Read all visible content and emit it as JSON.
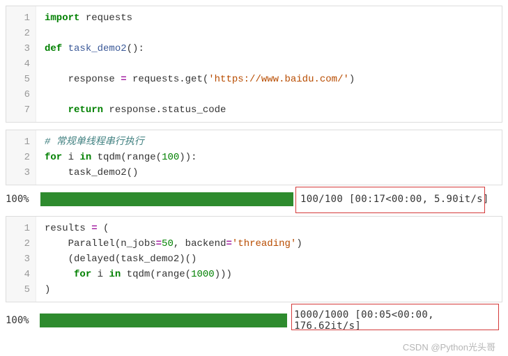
{
  "block1": {
    "lines": [
      "1",
      "2",
      "3",
      "4",
      "5",
      "6",
      "7"
    ],
    "l1_kw": "import",
    "l1_mod": " requests",
    "l3_kw": "def",
    "l3_fn": " task_demo2",
    "l3_rest": "():",
    "l5_a": "    response ",
    "l5_eq": "=",
    "l5_b": " requests.get(",
    "l5_str": "'https://www.baidu.com/'",
    "l5_c": ")",
    "l7_indent": "    ",
    "l7_kw": "return",
    "l7_rest": " response.status_code"
  },
  "block2": {
    "lines": [
      "1",
      "2",
      "3"
    ],
    "l1_cmt": "# 常规单线程串行执行",
    "l2_for": "for",
    "l2_a": " i ",
    "l2_in": "in",
    "l2_b": " tqdm(range(",
    "l2_num": "100",
    "l2_c": ")):",
    "l3": "    task_demo2()"
  },
  "progress1": {
    "pct": "100%",
    "label": "100/100 [00:17<00:00, 5.90it/s]"
  },
  "block3": {
    "lines": [
      "1",
      "2",
      "3",
      "4",
      "5"
    ],
    "l1_a": "results ",
    "l1_eq": "=",
    "l1_b": " (",
    "l2_a": "    Parallel(n_jobs",
    "l2_eq": "=",
    "l2_num": "50",
    "l2_b": ", backend",
    "l2_eq2": "=",
    "l2_str": "'threading'",
    "l2_c": ")",
    "l3": "    (delayed(task_demo2)()",
    "l4_indent": "     ",
    "l4_for": "for",
    "l4_a": " i ",
    "l4_in": "in",
    "l4_b": " tqdm(range(",
    "l4_num": "1000",
    "l4_c": ")))",
    "l5": ")"
  },
  "progress2": {
    "pct": "100%",
    "label": "1000/1000 [00:05<00:00, 176.62it/s]"
  },
  "watermark": "CSDN @Python光头哥"
}
